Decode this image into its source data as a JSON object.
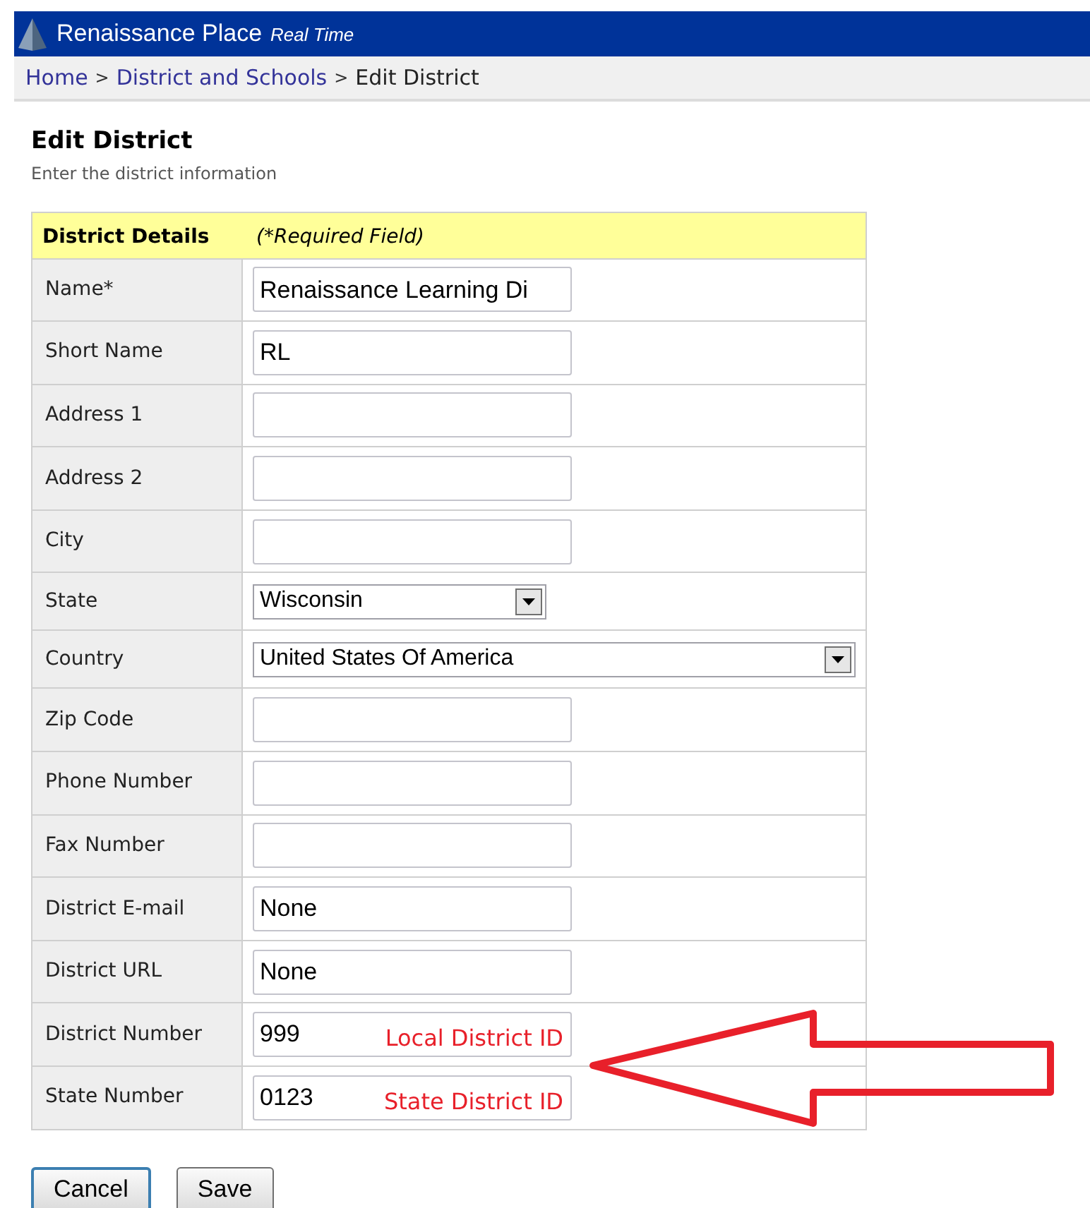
{
  "header": {
    "brand": "Renaissance Place",
    "tagline": "Real Time"
  },
  "breadcrumb": [
    {
      "label": "Home",
      "link": true
    },
    {
      "label": "District and Schools",
      "link": true
    },
    {
      "label": "Edit District",
      "link": false
    }
  ],
  "breadcrumb_separator": ">",
  "page": {
    "title": "Edit District",
    "subtitle": "Enter the district information"
  },
  "form": {
    "title": "District Details",
    "note": "(*Required Field)",
    "rows": [
      {
        "label": "Name*",
        "kind": "text",
        "value": "Renaissance Learning Di"
      },
      {
        "label": "Short Name",
        "kind": "text",
        "value": "RL"
      },
      {
        "label": "Address 1",
        "kind": "text"
      },
      {
        "label": "Address 2",
        "kind": "text"
      },
      {
        "label": "City",
        "kind": "text"
      },
      {
        "label": "State",
        "kind": "select",
        "value": "Wisconsin",
        "wide": false
      },
      {
        "label": "Country",
        "kind": "select",
        "value": "United States Of America",
        "wide": true
      },
      {
        "label": "Zip Code",
        "kind": "text"
      },
      {
        "label": "Phone Number",
        "kind": "text"
      },
      {
        "label": "Fax Number",
        "kind": "text"
      },
      {
        "label": "District E-mail",
        "kind": "text",
        "value": "None"
      },
      {
        "label": "District URL",
        "kind": "text",
        "value": "None"
      },
      {
        "label": "District Number",
        "kind": "text",
        "value": "999",
        "annotation": "Local District ID"
      },
      {
        "label": "State Number",
        "kind": "text",
        "value": "0123",
        "annotation": "State District ID"
      }
    ]
  },
  "buttons": [
    {
      "label": "Cancel",
      "focused": true
    },
    {
      "label": "Save",
      "focused": false
    }
  ]
}
